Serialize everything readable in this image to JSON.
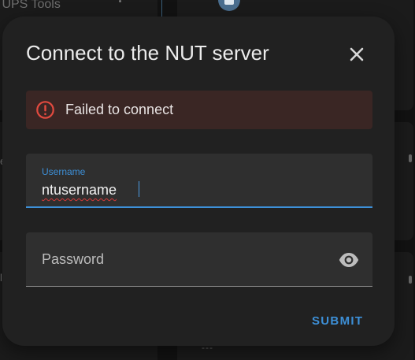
{
  "background": {
    "card_title": "k UPS Tools",
    "bottom_text": "---"
  },
  "dialog": {
    "title": "Connect to the NUT server",
    "close_icon": "close-icon",
    "alert": {
      "icon": "error-icon",
      "text": "Failed to connect"
    },
    "username": {
      "label": "Username",
      "value": "ntusername"
    },
    "password": {
      "placeholder": "Password",
      "toggle_icon": "eye-icon"
    },
    "submit_label": "Submit"
  },
  "colors": {
    "accent": "#3d90d8",
    "error": "#d33a3a",
    "dialog_background": "#212121",
    "alert_background": "#3a2624",
    "field_background": "#2f2f2f"
  }
}
